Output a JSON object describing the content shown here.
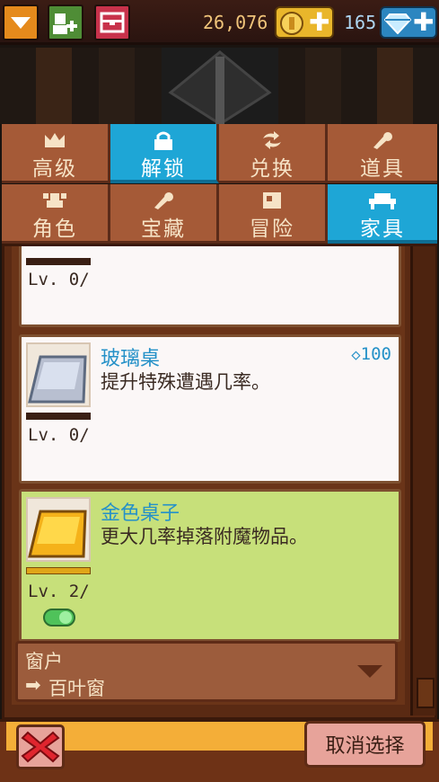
{
  "colors": {
    "tab_active": "#1ea6d6",
    "tab_inactive": "#a55a37",
    "item_name": "#2591c8",
    "selected_card": "#c7e07a",
    "coin": "#e9b62b",
    "gem": "#2c86c0"
  },
  "topbar": {
    "coins": "26,076",
    "gems": "165"
  },
  "tabs_primary": [
    {
      "label": "高级",
      "icon": "crown-icon"
    },
    {
      "label": "解锁",
      "icon": "lock-icon",
      "active": true
    },
    {
      "label": "兑换",
      "icon": "exchange-icon"
    },
    {
      "label": "道具",
      "icon": "potion-icon"
    }
  ],
  "tabs_secondary": [
    {
      "label": "角色",
      "icon": "character-icon"
    },
    {
      "label": "宝藏",
      "icon": "treasure-icon"
    },
    {
      "label": "冒险",
      "icon": "map-icon"
    },
    {
      "label": "家具",
      "icon": "furniture-icon",
      "active": true
    }
  ],
  "items": [
    {
      "level": "Lv.  0/"
    },
    {
      "name": "玻璃桌",
      "desc": "提升特殊遭遇几率。",
      "price": "100",
      "level": "Lv.  0/"
    },
    {
      "name": "金色桌子",
      "desc": "更大几率掉落附魔物品。",
      "level": "Lv.  2/",
      "selected": true
    }
  ],
  "window_select": {
    "label": "窗户",
    "value": "百叶窗"
  },
  "buttons": {
    "clear_selection": "取消选择"
  }
}
